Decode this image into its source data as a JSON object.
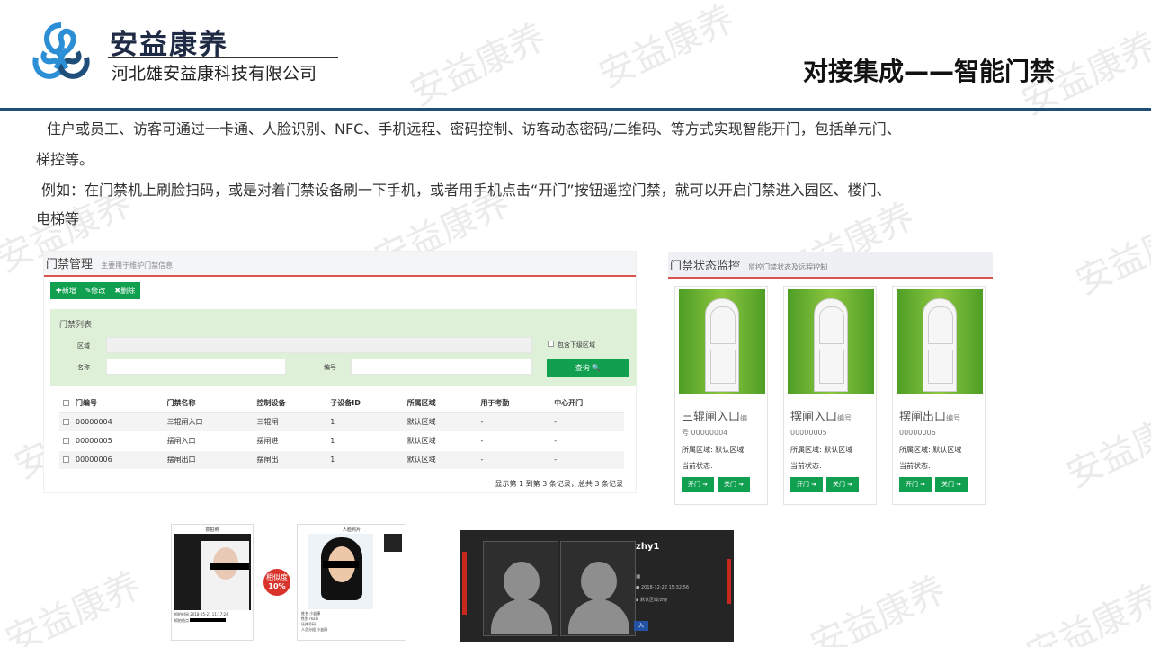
{
  "header": {
    "brand_name": "安益康养",
    "company": "河北雄安益康科技有限公司",
    "slide_title": "对接集成——智能门禁",
    "watermark": "安益康养"
  },
  "intro": {
    "line1": "住户或员工、访客可通过一卡通、人脸识别、NFC、手机远程、密码控制、访客动态密码/二维码、等方式实现智能开门，包括单元门、",
    "line2": "梯控等。",
    "line3": "例如：在门禁机上刷脸扫码，或是对着门禁设备刷一下手机，或者用手机点击“开门”按钮遥控门禁，就可以开启门禁进入园区、楼门、",
    "line4": "电梯等"
  },
  "door_mgmt": {
    "title": "门禁管理",
    "subtitle": "主要用于维护门禁信息",
    "toolbar": {
      "add": "✚新增",
      "edit": "✎修改",
      "delete": "✖删除"
    },
    "filter": {
      "title": "门禁列表",
      "area_label": "区域",
      "include_sub": "包含下级区域",
      "name_label": "名称",
      "number_label": "编号",
      "query_button": "查询 🔍"
    },
    "columns": [
      "门编号",
      "门禁名称",
      "控制设备",
      "子设备ID",
      "所属区域",
      "用于考勤",
      "中心开门"
    ],
    "rows": [
      [
        "00000004",
        "三辊闸入口",
        "三辊闸",
        "1",
        "默认区域",
        "-",
        "-"
      ],
      [
        "00000005",
        "摆闸入口",
        "摆闸进",
        "1",
        "默认区域",
        "-",
        "-"
      ],
      [
        "00000006",
        "摆闸出口",
        "摆闸出",
        "1",
        "默认区域",
        "-",
        "-"
      ]
    ],
    "pagination": "显示第 1 到第 3 条记录，总共 3 条记录"
  },
  "door_monitor": {
    "title": "门禁状态监控",
    "subtitle": "监控门禁状态及远程控制",
    "area_label": "所属区域: 默认区域",
    "status_label": "当前状态:",
    "open_button": "开门 ➜",
    "close_button": "关门 ➜",
    "cards": [
      {
        "name": "三辊闸入口",
        "no_label": "编",
        "number": "号 00000004"
      },
      {
        "name": "摆闸入口",
        "no_label": "编号",
        "number": "00000005"
      },
      {
        "name": "摆闸出口",
        "no_label": "编号",
        "number": "00000006"
      }
    ]
  },
  "face": {
    "panel1_title": "抓拍照",
    "panel2_title": "人脸照片",
    "match": "相似度",
    "match_value": "10%",
    "capture_time_label": "抓拍时间",
    "capture_time": "2018-05-21 11:17:24",
    "capture_place_label": "抓拍地点",
    "name_label": "姓名",
    "name_value": "小益康",
    "sex_label": "性别",
    "sex_value": "male",
    "id_label": "证件号码",
    "group_label": "人员分组",
    "group_value": "小益康",
    "user": "zhy1",
    "time": "2018-12-22 15:32:56",
    "area": "默认区域/zhy",
    "enter": "入"
  }
}
